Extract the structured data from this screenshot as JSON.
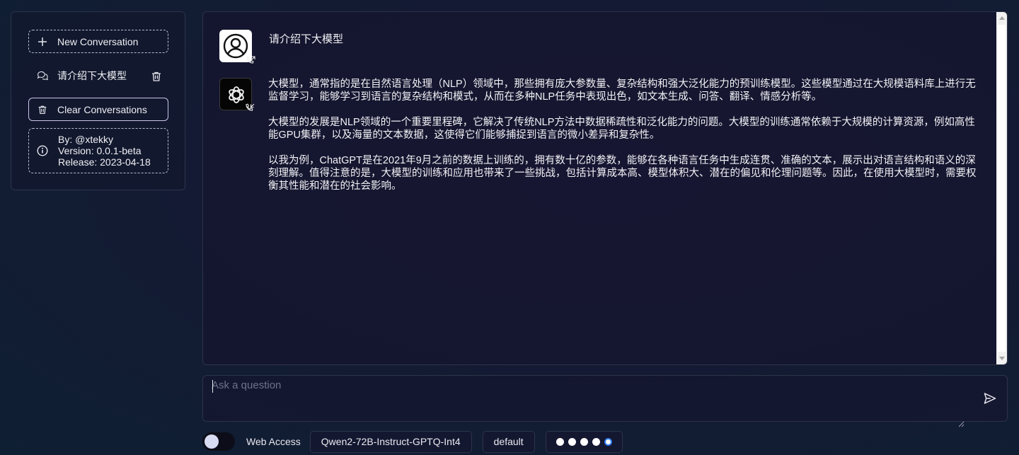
{
  "sidebar": {
    "new_conversation": "New Conversation",
    "conversations": [
      {
        "title": "请介绍下大模型"
      }
    ],
    "clear_conversations": "Clear Conversations",
    "info": {
      "by": "By: @xtekky",
      "version": "Version: 0.0.1-beta",
      "release": "Release: 2023-04-18"
    }
  },
  "chat": {
    "user_message": "请介绍下大模型",
    "assistant_paragraphs": [
      "大模型，通常指的是在自然语言处理（NLP）领域中，那些拥有庞大参数量、复杂结构和强大泛化能力的预训练模型。这些模型通过在大规模语料库上进行无监督学习，能够学习到语言的复杂结构和模式，从而在多种NLP任务中表现出色，如文本生成、问答、翻译、情感分析等。",
      "大模型的发展是NLP领域的一个重要里程碑，它解决了传统NLP方法中数据稀疏性和泛化能力的问题。大模型的训练通常依赖于大规模的计算资源，例如高性能GPU集群，以及海量的文本数据，这使得它们能够捕捉到语言的微小差异和复杂性。",
      "以我为例，ChatGPT是在2021年9月之前的数据上训练的，拥有数十亿的参数，能够在各种语言任务中生成连贯、准确的文本，展示出对语言结构和语义的深刻理解。值得注意的是，大模型的训练和应用也带来了一些挑战，包括计算成本高、模型体积大、潜在的偏见和伦理问题等。因此，在使用大模型时，需要权衡其性能和潜在的社会影响。"
    ]
  },
  "input": {
    "placeholder": "Ask a question"
  },
  "controls": {
    "web_access_label": "Web Access",
    "web_access_enabled": false,
    "model": "Qwen2-72B-Instruct-GPTQ-Int4",
    "preset": "default",
    "slider_steps": 5,
    "slider_selected": 5
  },
  "colors": {
    "accent": "#2f7cf6",
    "border": "#2d3448",
    "background": "#141a33"
  }
}
